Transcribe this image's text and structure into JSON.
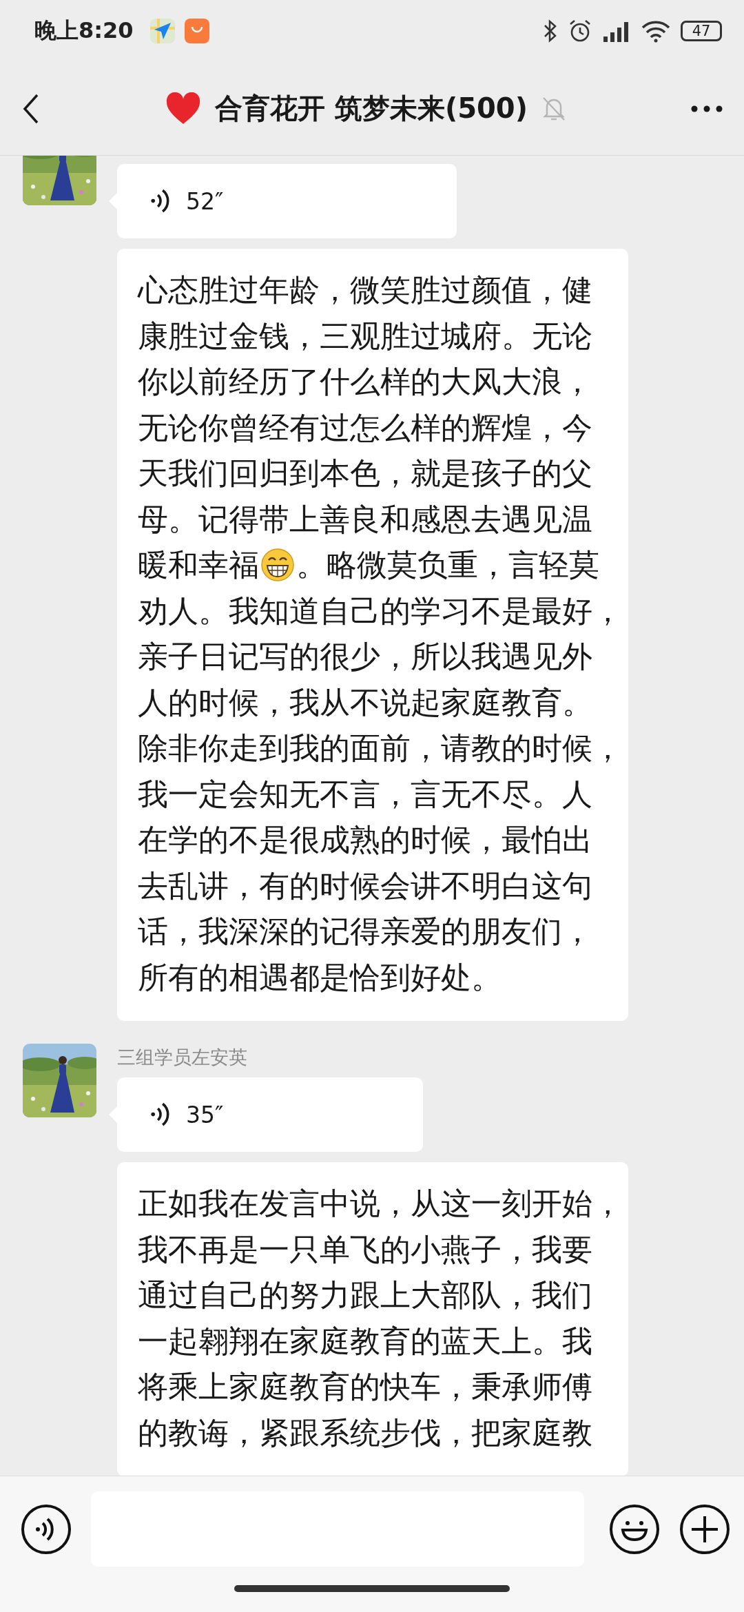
{
  "status_bar": {
    "time": "晚上8:20",
    "battery": "47"
  },
  "header": {
    "title": "合育花开 筑梦未来(500)",
    "muted": true
  },
  "groups": [
    {
      "messages": [
        {
          "kind": "voice",
          "duration": "52″"
        },
        {
          "kind": "text",
          "lines": [
            [
              {
                "kind": "text",
                "text": "心态胜过年龄，微笑胜过颜值，健"
              }
            ],
            [
              {
                "kind": "text",
                "text": "康胜过金钱，三观胜过城府。无论"
              }
            ],
            [
              {
                "kind": "text",
                "text": "你以前经历了什么样的大风大浪，"
              }
            ],
            [
              {
                "kind": "text",
                "text": "无论你曾经有过怎么样的辉煌，今"
              }
            ],
            [
              {
                "kind": "text",
                "text": "天我们回归到本色，就是孩子的父"
              }
            ],
            [
              {
                "kind": "text",
                "text": "母。记得带上善良和感恩去遇见温"
              }
            ],
            [
              {
                "kind": "text",
                "text": "暖和幸福"
              },
              {
                "kind": "emoji"
              },
              {
                "kind": "text",
                "text": "。略微莫负重，言轻莫"
              }
            ],
            [
              {
                "kind": "text",
                "text": "劝人。我知道自己的学习不是最好，"
              }
            ],
            [
              {
                "kind": "text",
                "text": "亲子日记写的很少，所以我遇见外"
              }
            ],
            [
              {
                "kind": "text",
                "text": "人的时候，我从不说起家庭教育。"
              }
            ],
            [
              {
                "kind": "text",
                "text": "除非你走到我的面前，请教的时候，"
              }
            ],
            [
              {
                "kind": "text",
                "text": "我一定会知无不言，言无不尽。人"
              }
            ],
            [
              {
                "kind": "text",
                "text": "在学的不是很成熟的时候，最怕出"
              }
            ],
            [
              {
                "kind": "text",
                "text": "去乱讲，有的时候会讲不明白这句"
              }
            ],
            [
              {
                "kind": "text",
                "text": "话，我深深的记得亲爱的朋友们，"
              }
            ],
            [
              {
                "kind": "text",
                "text": "所有的相遇都是恰到好处。"
              }
            ]
          ]
        }
      ]
    },
    {
      "sender": "三组学员左安英",
      "messages": [
        {
          "kind": "voice",
          "duration": "35″"
        },
        {
          "kind": "text",
          "lines": [
            [
              {
                "kind": "text",
                "text": "正如我在发言中说，从这一刻开始，"
              }
            ],
            [
              {
                "kind": "text",
                "text": "我不再是一只单飞的小燕子，我要"
              }
            ],
            [
              {
                "kind": "text",
                "text": "通过自己的努力跟上大部队，我们"
              }
            ],
            [
              {
                "kind": "text",
                "text": "一起翱翔在家庭教育的蓝天上。我"
              }
            ],
            [
              {
                "kind": "text",
                "text": "将乘上家庭教育的快车，秉承师傅"
              }
            ],
            [
              {
                "kind": "text",
                "text": "的教诲，紧跟系统步伐，把家庭教"
              }
            ]
          ]
        }
      ]
    }
  ]
}
